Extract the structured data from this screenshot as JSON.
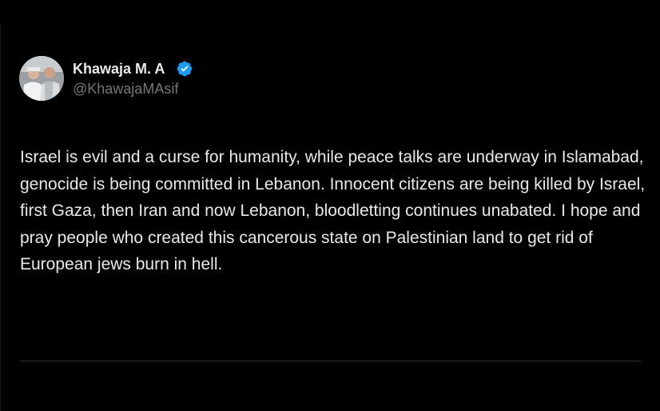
{
  "tweet": {
    "author": {
      "display_name": "Khawaja M. A",
      "handle": "@KhawajaMAsif",
      "verified": true,
      "avatar_icon": "avatar-photo",
      "verified_icon": "verified-badge-icon"
    },
    "text": "Israel is evil and a curse for humanity, while peace talks are underway in Islamabad, genocide is being committed in Lebanon. Innocent citizens are being killed by Israel, first Gaza, then Iran and now Lebanon, bloodletting continues unabated. I hope and pray people who created this cancerous state on Palestinian land to get rid of European jews burn in hell."
  },
  "colors": {
    "background": "#000000",
    "text": "#e7e9ea",
    "secondary_text": "#71767b",
    "verified_blue": "#1d9bf0",
    "divider": "#2f3336"
  }
}
